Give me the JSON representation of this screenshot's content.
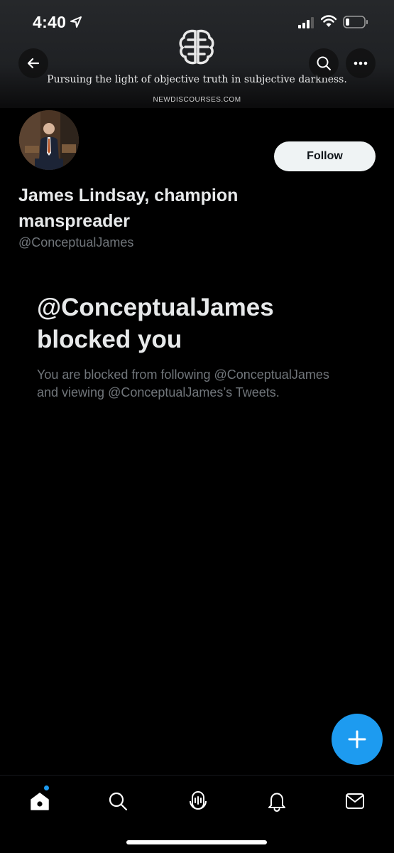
{
  "status_bar": {
    "time": "4:40"
  },
  "banner": {
    "tagline": "Pursuing the light of objective truth in subjective darkness.",
    "site": "NEWDISCOURSES.COM"
  },
  "profile": {
    "display_name": "James Lindsay, champion manspreader",
    "handle": "@ConceptualJames",
    "follow_label": "Follow"
  },
  "blocked": {
    "title": "@ConceptualJames blocked you",
    "description": "You are blocked from following @ConceptualJames and viewing @ConceptualJames’s Tweets."
  },
  "colors": {
    "accent": "#1d9bf0",
    "background": "#000000",
    "secondary_text": "#71767b"
  },
  "nav": {
    "icons": [
      "home-icon",
      "search-icon",
      "spaces-icon",
      "notifications-icon",
      "messages-icon"
    ]
  }
}
